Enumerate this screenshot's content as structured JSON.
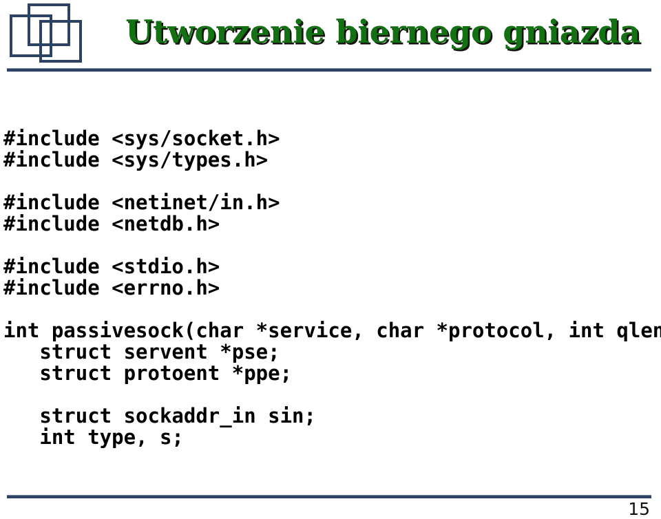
{
  "slide": {
    "title": "Utworzenie biernego gniazda",
    "page_number": "15",
    "logo_icon": "three-overlapping-squares-logo",
    "colors": {
      "title_green": "#137013",
      "title_shadow": "#17130f",
      "rule_navy": "#2c4262",
      "code_black": "#000000",
      "background": "#ffffff"
    }
  },
  "code": {
    "language": "c",
    "lines": [
      "#include <sys/socket.h>",
      "#include <sys/types.h>",
      "",
      "#include <netinet/in.h>",
      "#include <netdb.h>",
      "",
      "#include <stdio.h>",
      "#include <errno.h>",
      "",
      "int passivesock(char *service, char *protocol, int qlen){",
      "   struct servent *pse;",
      "   struct protoent *ppe;",
      "",
      "   struct sockaddr_in sin;",
      "   int type, s;"
    ]
  }
}
